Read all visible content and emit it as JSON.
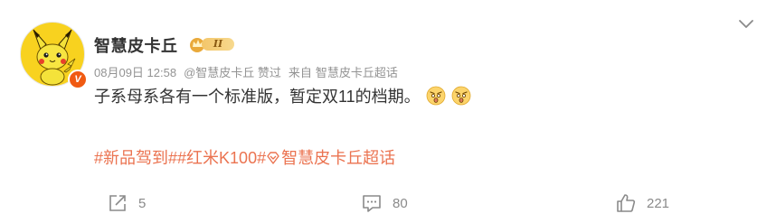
{
  "user": {
    "name": "智慧皮卡丘",
    "level": "II"
  },
  "meta": {
    "time": "08月09日 12:58",
    "source": "@智慧皮卡丘 赞过",
    "from_label": "来自",
    "from_value": "智慧皮卡丘超话"
  },
  "post": {
    "text": "子系母系各有一个标准版，暂定双11的档期。"
  },
  "hashtags": {
    "tag1": "#新品驾到#",
    "tag2": "#红米K100#",
    "supertopic": "智慧皮卡丘超话"
  },
  "actions": {
    "repost_count": "5",
    "comment_count": "80",
    "like_count": "221"
  },
  "icons": [
    "chevron-down-icon",
    "repost-icon",
    "comment-icon",
    "like-icon",
    "super-topic-icon",
    "verified-icon",
    "crown-icon"
  ],
  "colors": {
    "hashtag": "#eb7350",
    "verified": "#f05a12",
    "avatar_bg": "#f8d21f"
  }
}
